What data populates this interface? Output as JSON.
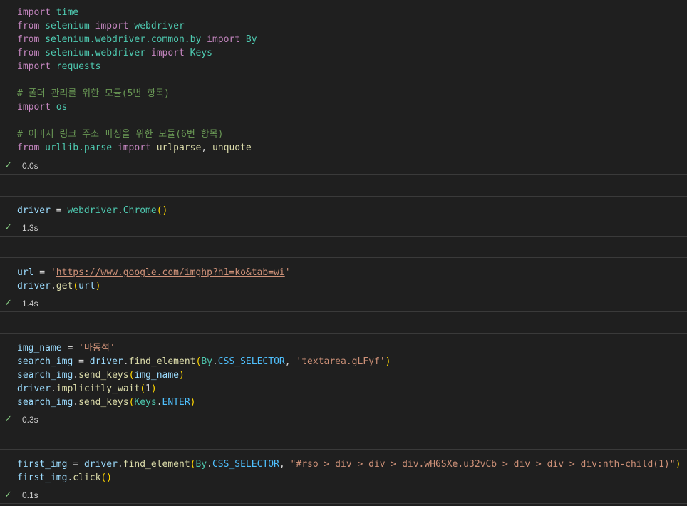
{
  "cells": [
    {
      "time": "0.0s",
      "lines": [
        [
          [
            "kw",
            "import"
          ],
          [
            "op",
            " "
          ],
          [
            "mod",
            "time"
          ]
        ],
        [
          [
            "kw",
            "from"
          ],
          [
            "op",
            " "
          ],
          [
            "mod",
            "selenium"
          ],
          [
            "op",
            " "
          ],
          [
            "kw",
            "import"
          ],
          [
            "op",
            " "
          ],
          [
            "mod",
            "webdriver"
          ]
        ],
        [
          [
            "kw",
            "from"
          ],
          [
            "op",
            " "
          ],
          [
            "mod",
            "selenium.webdriver.common.by"
          ],
          [
            "op",
            " "
          ],
          [
            "kw",
            "import"
          ],
          [
            "op",
            " "
          ],
          [
            "cls",
            "By"
          ]
        ],
        [
          [
            "kw",
            "from"
          ],
          [
            "op",
            " "
          ],
          [
            "mod",
            "selenium.webdriver"
          ],
          [
            "op",
            " "
          ],
          [
            "kw",
            "import"
          ],
          [
            "op",
            " "
          ],
          [
            "cls",
            "Keys"
          ]
        ],
        [
          [
            "kw",
            "import"
          ],
          [
            "op",
            " "
          ],
          [
            "mod",
            "requests"
          ]
        ],
        [],
        [
          [
            "cm",
            "# 폴더 관리를 위한 모듈(5번 항목)"
          ]
        ],
        [
          [
            "kw",
            "import"
          ],
          [
            "op",
            " "
          ],
          [
            "mod",
            "os"
          ]
        ],
        [],
        [
          [
            "cm",
            "# 이미지 링크 주소 파싱을 위한 모듈(6번 항목)"
          ]
        ],
        [
          [
            "kw",
            "from"
          ],
          [
            "op",
            " "
          ],
          [
            "mod",
            "urllib.parse"
          ],
          [
            "op",
            " "
          ],
          [
            "kw",
            "import"
          ],
          [
            "op",
            " "
          ],
          [
            "fn",
            "urlparse"
          ],
          [
            "op",
            ", "
          ],
          [
            "fn",
            "unquote"
          ]
        ]
      ]
    },
    {
      "time": "1.3s",
      "lines": [
        [
          [
            "var",
            "driver"
          ],
          [
            "op",
            " = "
          ],
          [
            "mod",
            "webdriver"
          ],
          [
            "op",
            "."
          ],
          [
            "cls",
            "Chrome"
          ],
          [
            "par",
            "()"
          ]
        ]
      ]
    },
    {
      "time": "1.4s",
      "lines": [
        [
          [
            "var",
            "url"
          ],
          [
            "op",
            " = "
          ],
          [
            "str",
            "'"
          ],
          [
            "url",
            "https://www.google.com/imghp?h1=ko&tab=wi"
          ],
          [
            "str",
            "'"
          ]
        ],
        [
          [
            "var",
            "driver"
          ],
          [
            "op",
            "."
          ],
          [
            "fn",
            "get"
          ],
          [
            "par",
            "("
          ],
          [
            "var",
            "url"
          ],
          [
            "par",
            ")"
          ]
        ]
      ]
    },
    {
      "time": "0.3s",
      "lines": [
        [
          [
            "var",
            "img_name"
          ],
          [
            "op",
            " = "
          ],
          [
            "str",
            "'마동석'"
          ]
        ],
        [
          [
            "var",
            "search_img"
          ],
          [
            "op",
            " = "
          ],
          [
            "var",
            "driver"
          ],
          [
            "op",
            "."
          ],
          [
            "fn",
            "find_element"
          ],
          [
            "par",
            "("
          ],
          [
            "cls",
            "By"
          ],
          [
            "op",
            "."
          ],
          [
            "const",
            "CSS_SELECTOR"
          ],
          [
            "op",
            ", "
          ],
          [
            "str",
            "'textarea.gLFyf'"
          ],
          [
            "par",
            ")"
          ]
        ],
        [
          [
            "var",
            "search_img"
          ],
          [
            "op",
            "."
          ],
          [
            "fn",
            "send_keys"
          ],
          [
            "par",
            "("
          ],
          [
            "var",
            "img_name"
          ],
          [
            "par",
            ")"
          ]
        ],
        [
          [
            "var",
            "driver"
          ],
          [
            "op",
            "."
          ],
          [
            "fn",
            "implicitly_wait"
          ],
          [
            "par",
            "("
          ],
          [
            "op",
            "1"
          ],
          [
            "par",
            ")"
          ]
        ],
        [
          [
            "var",
            "search_img"
          ],
          [
            "op",
            "."
          ],
          [
            "fn",
            "send_keys"
          ],
          [
            "par",
            "("
          ],
          [
            "cls",
            "Keys"
          ],
          [
            "op",
            "."
          ],
          [
            "const",
            "ENTER"
          ],
          [
            "par",
            ")"
          ]
        ]
      ]
    },
    {
      "time": "0.1s",
      "lines": [
        [
          [
            "var",
            "first_img"
          ],
          [
            "op",
            " = "
          ],
          [
            "var",
            "driver"
          ],
          [
            "op",
            "."
          ],
          [
            "fn",
            "find_element"
          ],
          [
            "par",
            "("
          ],
          [
            "cls",
            "By"
          ],
          [
            "op",
            "."
          ],
          [
            "const",
            "CSS_SELECTOR"
          ],
          [
            "op",
            ", "
          ],
          [
            "str",
            "\"#rso > div > div > div.wH6SXe.u32vCb > div > div > div:nth-child(1)\""
          ],
          [
            "par",
            ")"
          ]
        ],
        [
          [
            "var",
            "first_img"
          ],
          [
            "op",
            "."
          ],
          [
            "fn",
            "click"
          ],
          [
            "par",
            "()"
          ]
        ]
      ]
    }
  ],
  "icons": {
    "status": "check-icon"
  },
  "colors": {
    "background": "#1f1f1f",
    "success": "#89d185"
  }
}
